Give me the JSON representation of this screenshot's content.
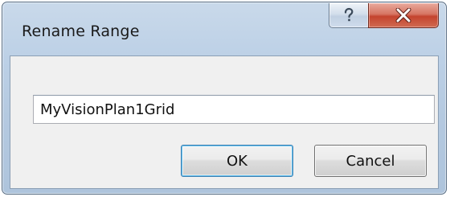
{
  "window": {
    "title": "Rename Range",
    "controls": {
      "help_icon": "question-mark-icon",
      "close_icon": "close-x-icon"
    }
  },
  "form": {
    "name_value": "MyVisionPlan1Grid"
  },
  "buttons": {
    "ok_label": "OK",
    "cancel_label": "Cancel"
  },
  "colors": {
    "title_bar": "#bcd0e6",
    "close_button": "#c4432e",
    "client_area": "#f0f0f0",
    "default_button_glow": "#66c2f0"
  }
}
